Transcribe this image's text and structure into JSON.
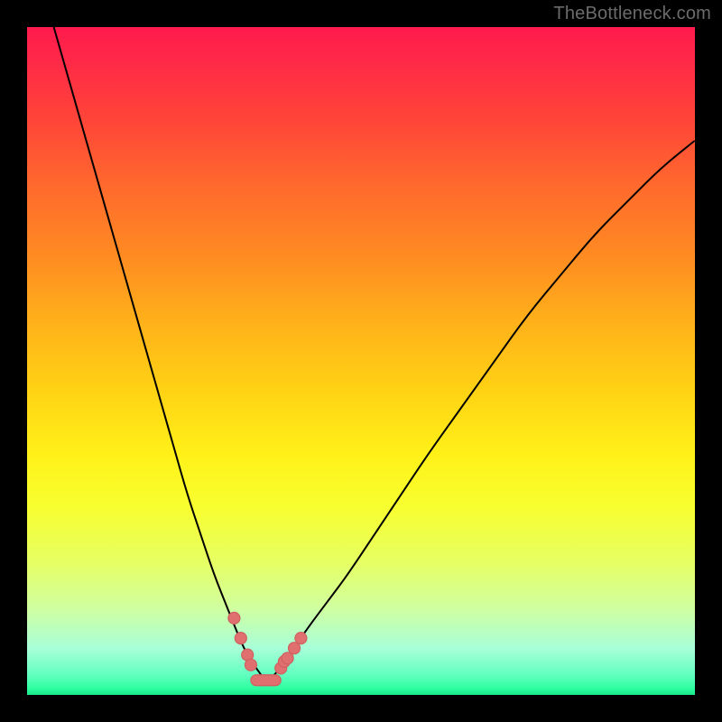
{
  "watermark": "TheBottleneck.com",
  "chart_data": {
    "type": "line",
    "title": "",
    "xlabel": "",
    "ylabel": "",
    "xlim": [
      0,
      100
    ],
    "ylim": [
      0,
      100
    ],
    "grid": false,
    "legend": false,
    "series": [
      {
        "name": "left-curve",
        "x": [
          4,
          6,
          8,
          10,
          12,
          14,
          16,
          18,
          20,
          22,
          24,
          26,
          28,
          30,
          32,
          33,
          34,
          35,
          36
        ],
        "values": [
          100,
          93,
          86,
          79,
          72,
          65,
          58,
          51,
          44,
          37,
          30,
          24,
          18,
          13,
          8,
          6,
          4.5,
          3,
          2
        ]
      },
      {
        "name": "right-curve",
        "x": [
          36,
          38,
          40,
          42,
          45,
          48,
          52,
          56,
          60,
          65,
          70,
          75,
          80,
          85,
          90,
          95,
          100
        ],
        "values": [
          2,
          4,
          7,
          10,
          14,
          18,
          24,
          30,
          36,
          43,
          50,
          57,
          63,
          69,
          74,
          79,
          83
        ]
      }
    ],
    "markers": {
      "name": "pink-markers",
      "color": "#e07070",
      "points": [
        {
          "x": 31.0,
          "y": 11.5
        },
        {
          "x": 32.0,
          "y": 8.5
        },
        {
          "x": 33.0,
          "y": 6.0
        },
        {
          "x": 33.5,
          "y": 4.5
        },
        {
          "x": 38.0,
          "y": 4.0
        },
        {
          "x": 38.5,
          "y": 5.0
        },
        {
          "x": 39.0,
          "y": 5.5
        },
        {
          "x": 40.0,
          "y": 7.0
        },
        {
          "x": 41.0,
          "y": 8.5
        }
      ],
      "flat_bar": {
        "x_start": 33.5,
        "x_end": 38.0,
        "y": 2.2
      }
    }
  }
}
